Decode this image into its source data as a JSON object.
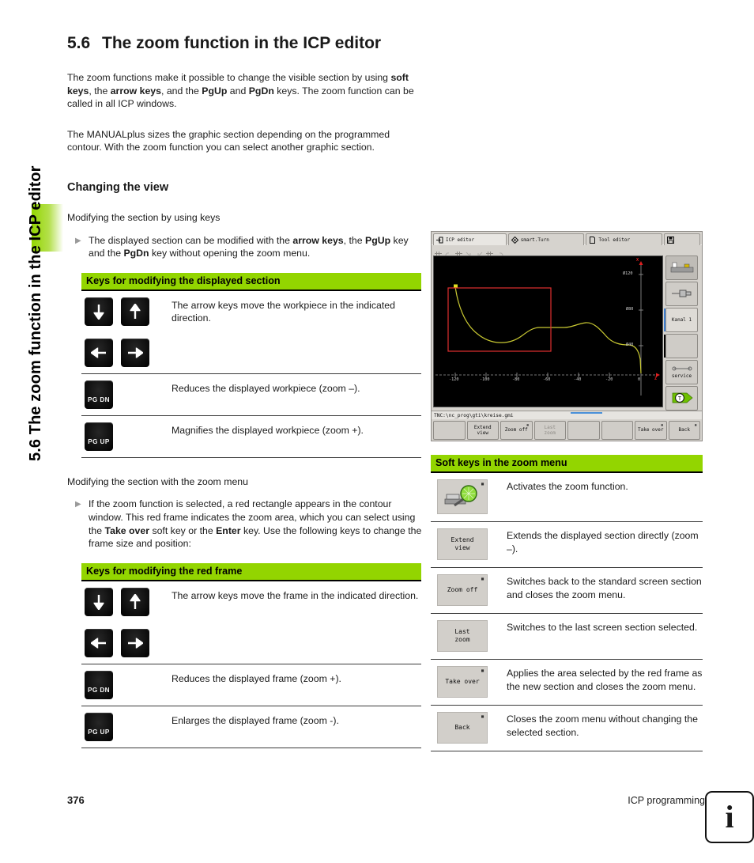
{
  "sidebar": {
    "running_title": "5.6 The zoom function in the ICP editor"
  },
  "heading": {
    "number": "5.6",
    "title": "The zoom function in the ICP editor"
  },
  "intro": {
    "p1_a": "The zoom functions make it possible to change the visible section by using ",
    "p1_b": "soft keys",
    "p1_c": ", the ",
    "p1_d": "arrow keys",
    "p1_e": ", and the ",
    "p1_f": "PgUp",
    "p1_g": " and ",
    "p1_h": "PgDn",
    "p1_i": " keys. The zoom function can be called in all ICP windows.",
    "p2": "The MANUALplus sizes the graphic section depending on the programmed contour. With the zoom function you can select another graphic section."
  },
  "changing_view": {
    "title": "Changing the view",
    "lead1": "Modifying the section by using keys",
    "bullet1_a": "The displayed section can be modified with the ",
    "bullet1_b": "arrow keys",
    "bullet1_c": ", the ",
    "bullet1_d": "PgUp",
    "bullet1_e": " key and the ",
    "bullet1_f": "PgDn",
    "bullet1_g": " key without opening the zoom menu.",
    "lead2": "Modifying the section with the zoom menu",
    "bullet2_a": "If the zoom function is selected, a red rectangle appears in the contour window. This red frame indicates the zoom area, which you can select using the ",
    "bullet2_b": "Take over",
    "bullet2_c": " soft key or the ",
    "bullet2_d": "Enter",
    "bullet2_e": " key. Use the following keys to change the frame size and position:"
  },
  "table_display": {
    "header": "Keys for modifying the displayed section",
    "rows": [
      {
        "keys": [
          "arrow-down",
          "arrow-up"
        ],
        "text": "The arrow keys move the workpiece in the indicated direction."
      },
      {
        "keys": [
          "arrow-left",
          "arrow-right"
        ],
        "text": ""
      },
      {
        "keys": [
          "pg-dn"
        ],
        "key_label": "PG DN",
        "text": "Reduces the displayed workpiece (zoom –)."
      },
      {
        "keys": [
          "pg-up"
        ],
        "key_label": "PG UP",
        "text": "Magnifies the displayed workpiece (zoom +)."
      }
    ]
  },
  "table_frame": {
    "header": "Keys for modifying the red frame",
    "rows": [
      {
        "keys": [
          "arrow-down",
          "arrow-up"
        ],
        "text": "The arrow keys move the frame in the indicated direction."
      },
      {
        "keys": [
          "arrow-left",
          "arrow-right"
        ],
        "text": ""
      },
      {
        "keys": [
          "pg-dn"
        ],
        "key_label": "PG DN",
        "text": "Reduces the displayed frame (zoom +)."
      },
      {
        "keys": [
          "pg-up"
        ],
        "key_label": "PG UP",
        "text": "Enlarges the displayed frame (zoom -)."
      }
    ]
  },
  "machine_screen": {
    "tabs": [
      {
        "label": "ICP editor",
        "icon": "arrow-into-box-icon"
      },
      {
        "label": "smart.Turn",
        "icon": "diamond-icon"
      },
      {
        "label": "Tool editor",
        "icon": "page-icon"
      },
      {
        "label": "",
        "icon": "save-disk-icon"
      }
    ],
    "status_path": "TNC:\\nc_prog\\gti\\kreise.gmi",
    "vertical_keys": [
      {
        "label": "",
        "icon": "machine-icon"
      },
      {
        "label": "",
        "icon": "tool-icon"
      },
      {
        "label": "Kanal 1",
        "icon": ""
      },
      {
        "label": "",
        "icon": ""
      },
      {
        "label": "service",
        "icon": "wrench-icon"
      },
      {
        "label": "",
        "icon": "t-key-icon"
      }
    ],
    "soft_keys": [
      {
        "label": "",
        "dimmed": false,
        "mark": false
      },
      {
        "label": "Extend\nview",
        "dimmed": false,
        "mark": false
      },
      {
        "label": "Zoom off",
        "dimmed": false,
        "mark": true
      },
      {
        "label": "Last\nzoom",
        "dimmed": true,
        "mark": false
      },
      {
        "label": "",
        "dimmed": false,
        "mark": false
      },
      {
        "label": "",
        "dimmed": false,
        "mark": false
      },
      {
        "label": "Take over",
        "dimmed": false,
        "mark": true
      },
      {
        "label": "Back",
        "dimmed": false,
        "mark": true
      }
    ],
    "graph": {
      "x_axis_label": "Z",
      "y_axis_label": "X",
      "x_ticks": [
        "-120",
        "-100",
        "-80",
        "-60",
        "-40",
        "-20",
        "0"
      ],
      "y_ticks": [
        "Ø120",
        "Ø80",
        "Ø40"
      ],
      "contour_color": "#c8c832",
      "zoom_frame_color": "#e03030",
      "background": "#000000"
    }
  },
  "softkey_table": {
    "header": "Soft keys in the zoom menu",
    "rows": [
      {
        "key_label": "",
        "icon": "magnifier-workpiece-icon",
        "mark": true,
        "text": "Activates the zoom function."
      },
      {
        "key_label": "Extend\nview",
        "icon": "",
        "mark": false,
        "text": "Extends the displayed section directly (zoom –)."
      },
      {
        "key_label": "Zoom off",
        "icon": "",
        "mark": true,
        "text": "Switches back to the standard screen section and closes the zoom menu."
      },
      {
        "key_label": "Last\nzoom",
        "icon": "",
        "mark": false,
        "text": "Switches to the last screen section selected."
      },
      {
        "key_label": "Take over",
        "icon": "",
        "mark": true,
        "text": "Applies the area selected by the red frame as the new section and closes the zoom menu."
      },
      {
        "key_label": "Back",
        "icon": "",
        "mark": true,
        "text": "Closes the zoom menu without changing the selected section."
      }
    ]
  },
  "footer": {
    "page_number": "376",
    "chapter": "ICP programming",
    "info_glyph": "i"
  },
  "colors": {
    "accent_green": "#93d500",
    "key_black": "#0c0c0c",
    "machine_gray": "#d6d3ce"
  }
}
